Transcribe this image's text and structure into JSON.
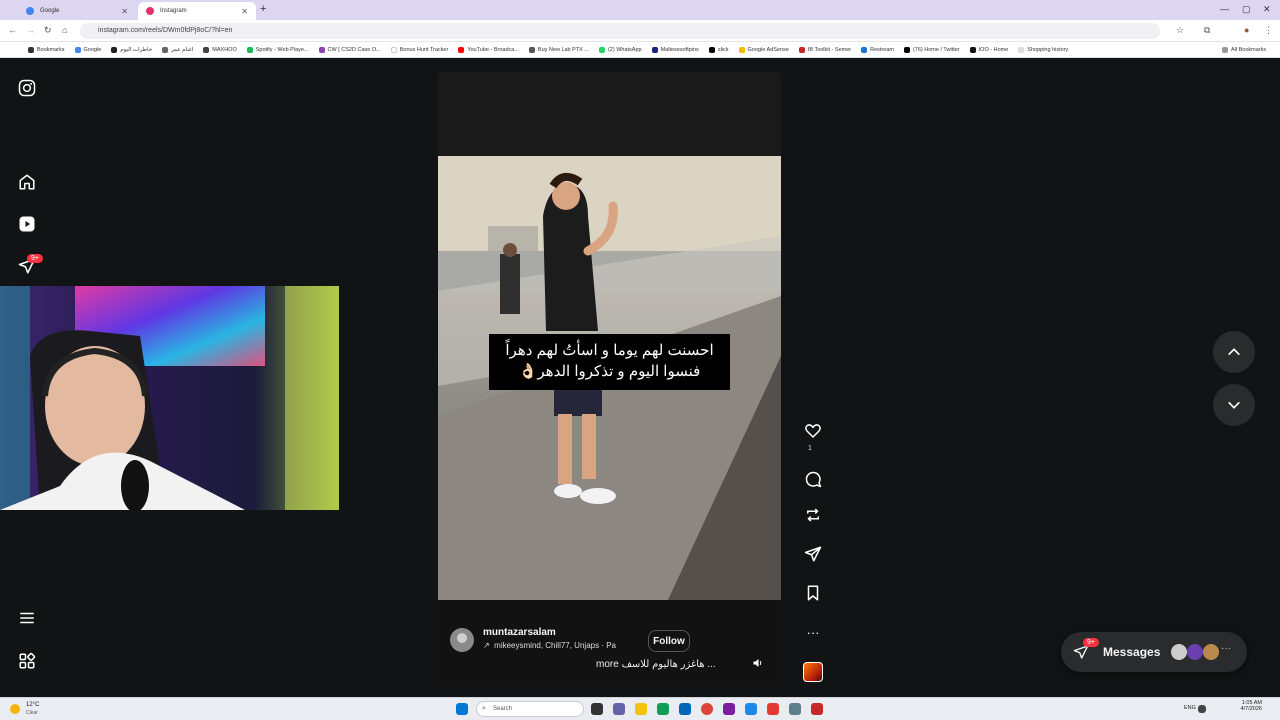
{
  "browser": {
    "tabs": [
      {
        "label": "Google",
        "active": false
      },
      {
        "label": "Instagram",
        "active": true
      }
    ],
    "url": "instagram.com/reels/DWm0fdPj8oC/?hl=en",
    "bookmarks": [
      "Bookmarks",
      "Google",
      "خاطرات اليوم",
      "اغنام عمر",
      "MAXHOO",
      "Spotify - Web Playe...",
      "CW [ CS2D Case O...",
      "Bonus Hunt Tracker",
      "YouTube - Broadca...",
      "Buy New Lab PTX ...",
      "(2) WhatsApp",
      "Maltesesoftpins",
      "slick",
      "Google AdSense",
      "IB Toolkit - Semer",
      "Restream",
      "(76) Home / Twitter",
      "IOO - Home",
      "Shopping history"
    ],
    "all_bookmarks": "All Bookmarks"
  },
  "sidebar": {
    "notifications_badge": "9+"
  },
  "reel": {
    "caption_line1": "احسنت لهم يوما و اسأتُ لهم دهراً",
    "caption_line2": "فنسوا اليوم و تذكروا الدهر👌🏻",
    "username": "muntazarsalam",
    "collab": "mikeeysmind, Chill77, Unjaps · Pa",
    "follow_label": "Follow",
    "description": "هاغزر هاليوم للاسف ...",
    "more_label": "more",
    "like_count": "1"
  },
  "messages": {
    "label": "Messages",
    "badge": "9+"
  },
  "taskbar": {
    "weather_temp": "12°C",
    "weather_desc": "Clear",
    "search_placeholder": "Search",
    "lang": "ENG",
    "time": "1:05 AM",
    "date": "4/7/2026"
  },
  "colors": {
    "accent_red": "#ff3040",
    "page_bg": "#121314",
    "panel_bg": "#2a2b2d"
  }
}
